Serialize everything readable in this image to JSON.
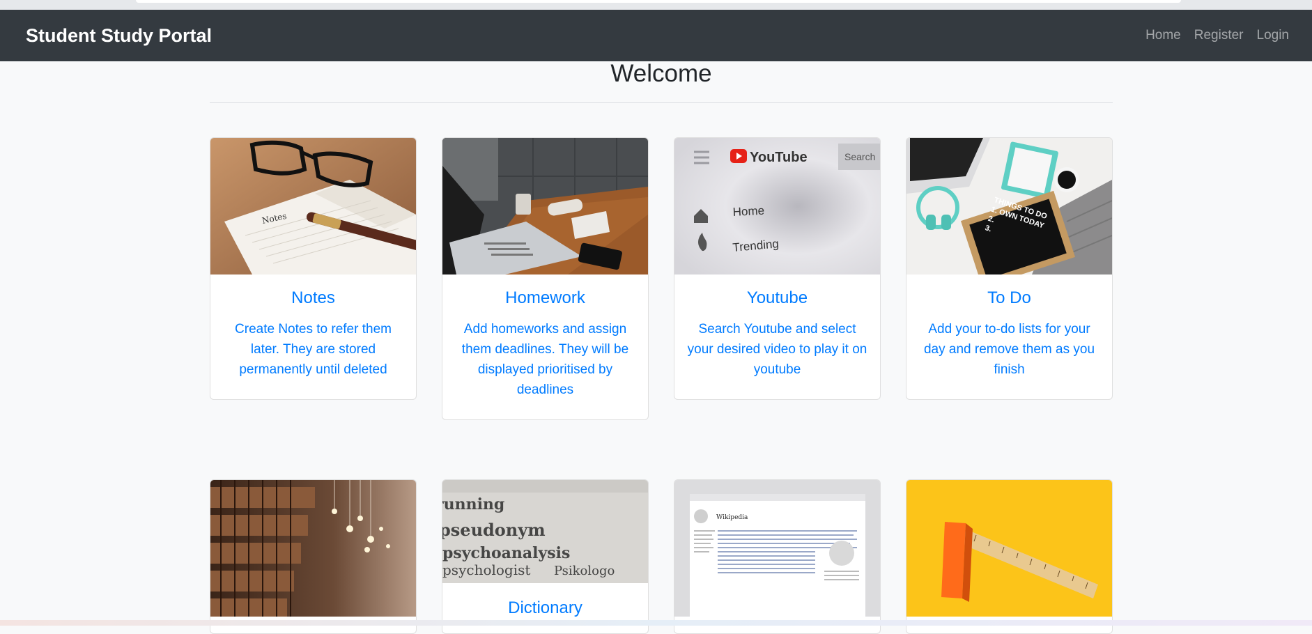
{
  "navbar": {
    "brand": "Student Study Portal",
    "links": [
      "Home",
      "Register",
      "Login"
    ]
  },
  "welcome": "Welcome",
  "cards": [
    {
      "title": "Notes",
      "desc": "Create Notes to refer them later. They are stored permanently until deleted"
    },
    {
      "title": "Homework",
      "desc": "Add homeworks and assign them deadlines. They will be displayed prioritised by deadlines"
    },
    {
      "title": "Youtube",
      "desc": "Search Youtube and select your desired video to play it on youtube"
    },
    {
      "title": "To Do",
      "desc": "Add your to-do lists for your day and remove them as you finish"
    },
    {
      "title": "",
      "desc": ""
    },
    {
      "title": "Dictionary",
      "desc": ""
    },
    {
      "title": "",
      "desc": ""
    },
    {
      "title": "",
      "desc": ""
    }
  ],
  "images": {
    "youtube_brand": "YouTube",
    "youtube_search": "Search",
    "youtube_menu": [
      "Home",
      "Trending"
    ],
    "notebook_word": "Notes",
    "todo_board_lines": [
      "THINGS TO DO",
      "1. OWN TODAY",
      "2.",
      "3."
    ],
    "dictionary_words": [
      "running",
      "pseudonym",
      "psychoanalysis",
      "psychologist",
      "Psikologo"
    ],
    "wiki_title": "Wikipedia"
  },
  "colors": {
    "navbar": "#343a40",
    "link": "#007bff",
    "background": "#f8f9fa"
  }
}
